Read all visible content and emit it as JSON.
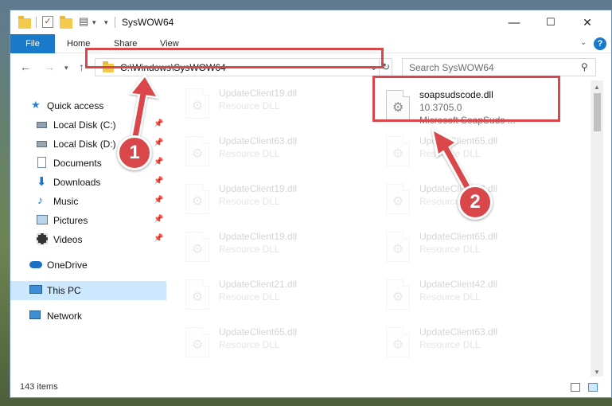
{
  "window": {
    "title": "SysWOW64",
    "controls": {
      "minimize": "—",
      "maximize": "☐",
      "close": "✕"
    }
  },
  "ribbon": {
    "tabs": [
      "File",
      "Home",
      "Share",
      "View"
    ],
    "help": "?"
  },
  "address": {
    "path": "C:\\Windows\\SysWOW64",
    "search_placeholder": "Search SysWOW64"
  },
  "sidebar": {
    "items": [
      {
        "label": "Quick access",
        "icon": "star-icon",
        "pinned": false
      },
      {
        "label": "Local Disk (C:)",
        "icon": "drive-icon",
        "pinned": true
      },
      {
        "label": "Local Disk (D:)",
        "icon": "drive-icon",
        "pinned": true
      },
      {
        "label": "Documents",
        "icon": "documents-icon",
        "pinned": true
      },
      {
        "label": "Downloads",
        "icon": "download-icon",
        "pinned": true
      },
      {
        "label": "Music",
        "icon": "music-icon",
        "pinned": true
      },
      {
        "label": "Pictures",
        "icon": "pictures-icon",
        "pinned": true
      },
      {
        "label": "Videos",
        "icon": "videos-icon",
        "pinned": true
      },
      {
        "label": "OneDrive",
        "icon": "cloud-icon",
        "pinned": false
      },
      {
        "label": "This PC",
        "icon": "pc-icon",
        "pinned": false,
        "selected": true
      },
      {
        "label": "Network",
        "icon": "network-icon",
        "pinned": false
      }
    ]
  },
  "files": {
    "left_column": [
      {
        "name": "UpdateClient19.dll",
        "type": "Resource DLL"
      },
      {
        "name": "UpdateClient63.dll",
        "type": "Resource DLL"
      },
      {
        "name": "UpdateClient19.dll",
        "type": "Resource DLL"
      },
      {
        "name": "UpdateClient19.dll",
        "type": "Resource DLL"
      },
      {
        "name": "UpdateClient21.dll",
        "type": "Resource DLL"
      },
      {
        "name": "UpdateClient65.dll",
        "type": "Resource DLL"
      }
    ],
    "highlighted": {
      "name": "soapsudscode.dll",
      "version": "10.3705.0",
      "description": "Microsoft SoapSuds ..."
    },
    "right_column": [
      {
        "name": "UpdateClient65.dll",
        "type": "Resource DLL"
      },
      {
        "name": "UpdateClient63.dll",
        "type": "Resource DLL"
      },
      {
        "name": "UpdateClient65.dll",
        "type": "Resource DLL"
      },
      {
        "name": "UpdateClient42.dll",
        "type": "Resource DLL"
      },
      {
        "name": "UpdateClient63.dll",
        "type": "Resource DLL"
      }
    ]
  },
  "status": {
    "item_count": "143 items"
  },
  "annotations": {
    "step1": "1",
    "step2": "2",
    "color": "#d9474b"
  }
}
